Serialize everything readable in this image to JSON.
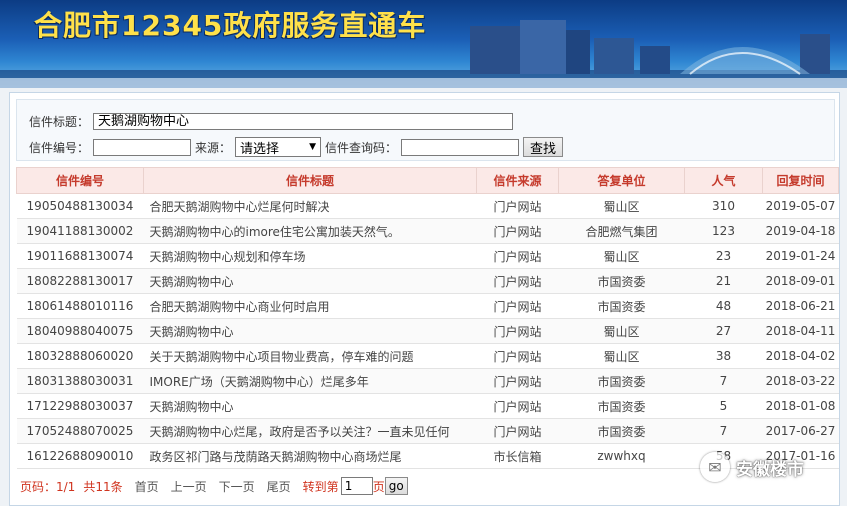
{
  "header": {
    "title": "合肥市12345政府服务直通车"
  },
  "search": {
    "title_label": "信件标题：",
    "title_value": "天鹅湖购物中心",
    "number_label": "信件编号：",
    "number_value": "",
    "source_label": "来源：",
    "source_selected": "请选择",
    "query_code_label": "信件查询码：",
    "query_code_value": "",
    "search_button": "查找"
  },
  "table": {
    "columns": [
      "信件编号",
      "信件标题",
      "信件来源",
      "答复单位",
      "人气",
      "回复时间"
    ],
    "rows": [
      [
        "19050488130034",
        "合肥天鹅湖购物中心烂尾何时解决",
        "门户网站",
        "蜀山区",
        "310",
        "2019-05-07"
      ],
      [
        "19041188130002",
        "天鹅湖购物中心的imore住宅公寓加装天然气。",
        "门户网站",
        "合肥燃气集团",
        "123",
        "2019-04-18"
      ],
      [
        "19011688130074",
        "天鹅湖购物中心规划和停车场",
        "门户网站",
        "蜀山区",
        "23",
        "2019-01-24"
      ],
      [
        "18082288130017",
        "天鹅湖购物中心",
        "门户网站",
        "市国资委",
        "21",
        "2018-09-01"
      ],
      [
        "18061488010116",
        "合肥天鹅湖购物中心商业何时启用",
        "门户网站",
        "市国资委",
        "48",
        "2018-06-21"
      ],
      [
        "18040988040075",
        "天鹅湖购物中心",
        "门户网站",
        "蜀山区",
        "27",
        "2018-04-11"
      ],
      [
        "18032888060020",
        "关于天鹅湖购物中心项目物业费高，停车难的问题",
        "门户网站",
        "蜀山区",
        "38",
        "2018-04-02"
      ],
      [
        "18031388030031",
        "IMORE广场（天鹅湖购物中心）烂尾多年",
        "门户网站",
        "市国资委",
        "7",
        "2018-03-22"
      ],
      [
        "17122988030037",
        "天鹅湖购物中心",
        "门户网站",
        "市国资委",
        "5",
        "2018-01-08"
      ],
      [
        "17052488070025",
        "天鹅湖购物中心烂尾，政府是否予以关注？一直未见任何",
        "门户网站",
        "市国资委",
        "7",
        "2017-06-27"
      ],
      [
        "16122688090010",
        "政务区祁门路与茂荫路天鹅湖购物中心商场烂尾",
        "市长信箱",
        "zwwhxq",
        "58",
        "2017-01-16"
      ]
    ]
  },
  "pager": {
    "page_info": "页码：1/1",
    "total": "共11条",
    "first": "首页",
    "prev": "上一页",
    "next": "下一页",
    "last": "尾页",
    "goto_label": "转到第",
    "page_value": "1",
    "page_suffix": "页",
    "go_button": "go"
  },
  "watermark": {
    "text": "安徽楼市"
  },
  "colors": {
    "banner_title": "#ffe14a",
    "header_text": "#c53a2c",
    "header_bg": "#fbe9e7",
    "pager_red": "#d0341f"
  }
}
